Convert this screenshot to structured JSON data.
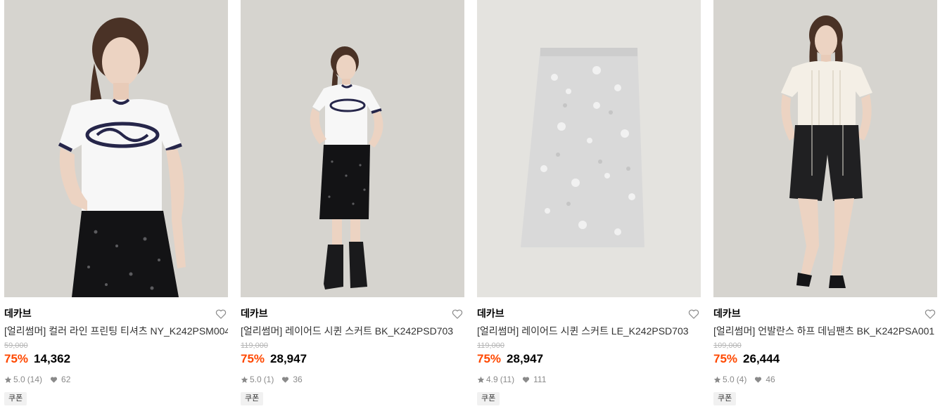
{
  "products": [
    {
      "brand": "데카브",
      "name": "[얼리썸머] 컬러 라인 프린팅 티셔츠 NY_K242PSM004",
      "original_price": "59,000",
      "discount": "75%",
      "price": "14,362",
      "rating": "5.0",
      "review_count": "(14)",
      "likes": "62",
      "badge": "쿠폰",
      "image_alt": "model wearing white ringer t-shirt with navy print and black sequin skirt"
    },
    {
      "brand": "데카브",
      "name": "[얼리썸머] 레이어드 시퀸 스커트 BK_K242PSD703",
      "original_price": "119,000",
      "discount": "75%",
      "price": "28,947",
      "rating": "5.0",
      "review_count": "(1)",
      "likes": "36",
      "badge": "쿠폰",
      "image_alt": "full-body model wearing white t-shirt, black sequin skirt and black boots"
    },
    {
      "brand": "데카브",
      "name": "[얼리썸머] 레이어드 시퀸 스커트 LE_K242PSD703",
      "original_price": "119,000",
      "discount": "75%",
      "price": "28,947",
      "rating": "4.9",
      "review_count": "(11)",
      "likes": "111",
      "badge": "쿠폰",
      "image_alt": "light grey sequin midi skirt product shot"
    },
    {
      "brand": "데카브",
      "name": "[얼리썸머] 언발란스 하프 데님팬츠 BK_K242PSA001",
      "original_price": "109,000",
      "discount": "75%",
      "price": "26,444",
      "rating": "5.0",
      "review_count": "(4)",
      "likes": "46",
      "badge": "쿠폰",
      "image_alt": "model wearing cream blouse and black denim half pants with sandals"
    }
  ],
  "colors": {
    "discount": "#ff4800",
    "strike_price": "#b5b5b5",
    "meta": "#8a8a8a",
    "photo_bg_1": "#d6d4cf",
    "photo_bg_3": "#e4e3df"
  },
  "icons": {
    "like": "heart-outline-icon",
    "rating": "star-icon",
    "likes": "heart-filled-icon"
  }
}
